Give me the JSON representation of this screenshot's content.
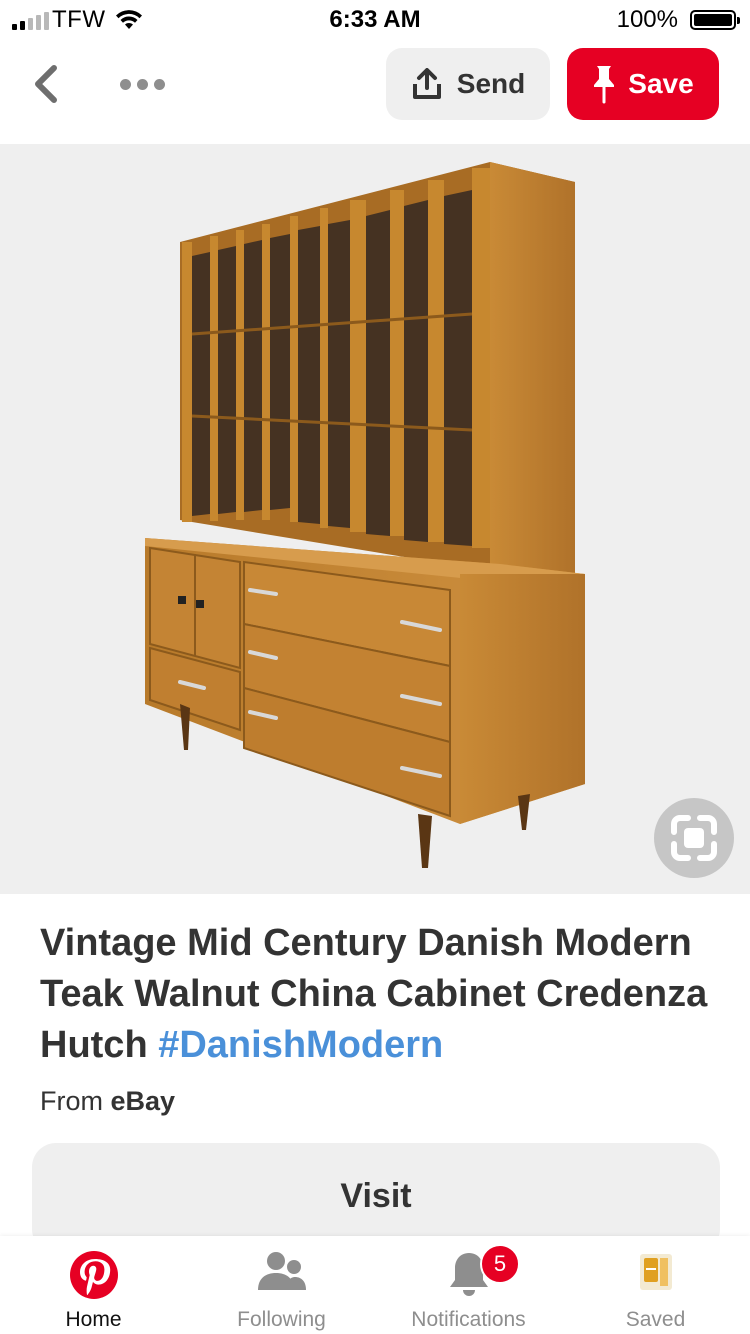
{
  "status_bar": {
    "carrier": "TFW",
    "time": "6:33 AM",
    "battery": "100%"
  },
  "toolbar": {
    "send_label": "Send",
    "save_label": "Save"
  },
  "pin": {
    "title": "Vintage Mid Century Danish Modern Teak Walnut China Cabinet Credenza Hutch",
    "hashtag": "#DanishModern",
    "source_prefix": "From",
    "source_name": "eBay",
    "visit_label": "Visit"
  },
  "tabs": [
    {
      "label": "Home",
      "icon": "pinterest-logo-icon",
      "active": true
    },
    {
      "label": "Following",
      "icon": "people-icon",
      "active": false
    },
    {
      "label": "Notifications",
      "icon": "bell-icon",
      "active": false,
      "badge": "5"
    },
    {
      "label": "Saved",
      "icon": "saved-thumbnail-icon",
      "active": false
    }
  ],
  "colors": {
    "brand_red": "#e60023",
    "hashtag_blue": "#4a90d9",
    "text_dark": "#333333",
    "button_gray": "#efefef"
  }
}
